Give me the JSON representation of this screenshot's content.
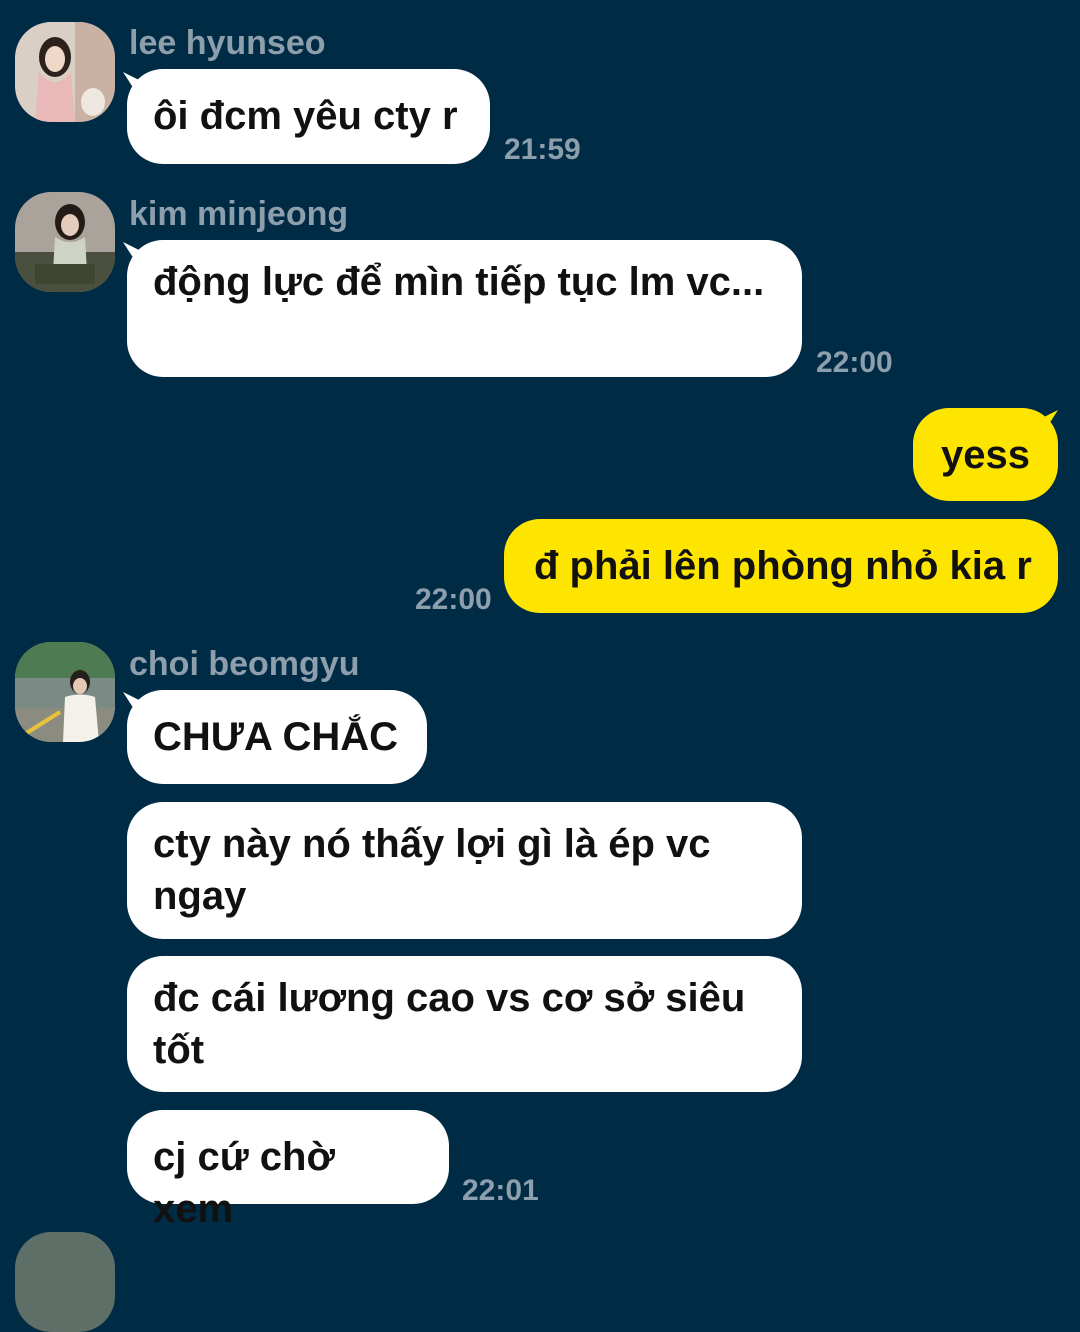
{
  "messages": [
    {
      "sender": "lee hyunseo",
      "bubbles": [
        "ôi đcm yêu cty r"
      ],
      "time": "21:59"
    },
    {
      "sender": "kim minjeong",
      "bubbles": [
        "động lực để mìn tiếp tục lm vc..."
      ],
      "time": "22:00"
    },
    {
      "sender": "me",
      "bubbles": [
        "yess",
        "đ phải lên phòng nhỏ kia r"
      ],
      "time": "22:00"
    },
    {
      "sender": "choi beomgyu",
      "bubbles": [
        "CHƯA CHẮC",
        "cty này nó thấy lợi gì là ép vc ngay",
        "đc cái lương cao vs cơ sở siêu tốt",
        "cj cứ chờ xem"
      ],
      "time": "22:01"
    }
  ],
  "colors": {
    "background": "#002b44",
    "incoming_bubble": "#ffffff",
    "outgoing_bubble": "#fee500",
    "meta_text": "#8d9eac"
  }
}
